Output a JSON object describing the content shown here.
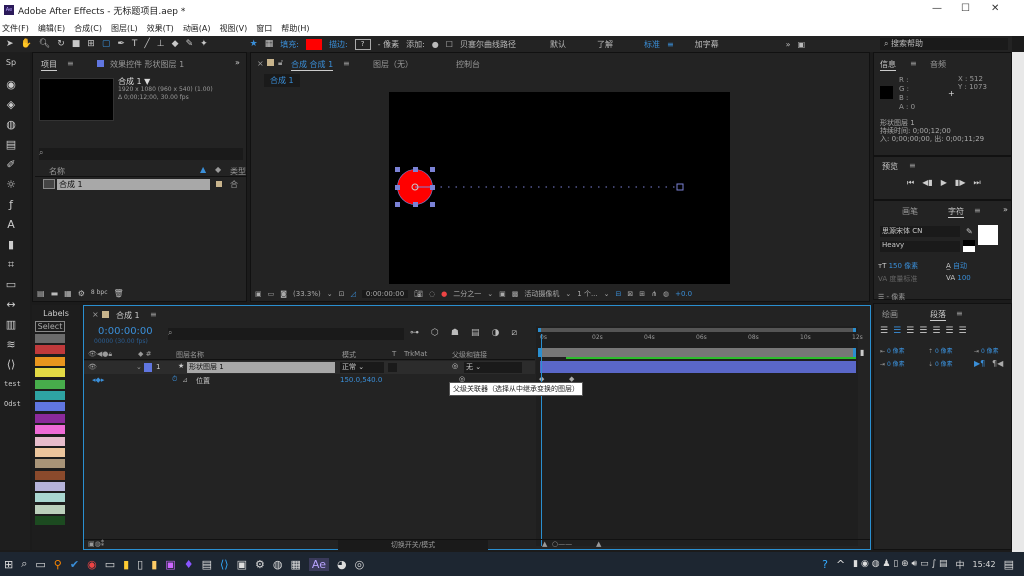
{
  "window": {
    "title": "Adobe After Effects - 无标题项目.aep *",
    "logo": "Ae"
  },
  "menu": [
    "文件(F)",
    "编辑(E)",
    "合成(C)",
    "图层(L)",
    "效果(T)",
    "动画(A)",
    "视图(V)",
    "窗口",
    "帮助(H)"
  ],
  "toolbar": {
    "fill_label": "填充:",
    "stroke_label": "描边:",
    "stroke_value": "?",
    "px_label": "- 像素",
    "add_label": "添加:",
    "bezier_label": "贝塞尔曲线路径",
    "workspaces": [
      "默认",
      "了解",
      "标准",
      "加字幕"
    ],
    "active_workspace": "标准",
    "search_placeholder": "搜索帮助",
    "fill_color": "#ff0000"
  },
  "project": {
    "tab": "项目",
    "effects_tab": "效果控件 形状图层 1",
    "comp_name": "合成 1 ▼",
    "comp_size": "1920 x 1080  (960 x 540) (1.00)",
    "comp_duration": "Δ 0;00;12;00, 30.00 fps",
    "col_name": "名称",
    "col_type": "类型",
    "items": [
      {
        "name": "合成 1",
        "type": "合"
      }
    ],
    "bpc": "8 bpc"
  },
  "comp": {
    "tab": "合成 合成 1",
    "layer_tab": "图层（无）",
    "console_tab": "控制台",
    "breadcrumb": "合成 1",
    "zoom": "(33.3%)",
    "timecode": "0:00:00:00",
    "resolution": "二分之一",
    "camera": "活动摄像机",
    "views": "1 个...",
    "exposure": "+0.0"
  },
  "info": {
    "tab": "信息",
    "audio_tab": "音频",
    "r": "R :",
    "g": "G :",
    "b": "B :",
    "a": "A : 0",
    "x": "X : 512",
    "y": "Y : 1073",
    "layer": "形状图层 1",
    "duration": "持续时间: 0;00;12;00",
    "inout": "入: 0;00;00;00,  出: 0;00;11;29"
  },
  "preview": {
    "tab": "预览"
  },
  "character": {
    "brush_tab": "画笔",
    "tab": "字符",
    "font": "思源宋体 CN",
    "style": "Heavy",
    "size": "150 像素",
    "leading": "自动",
    "kerning": "度量标准",
    "tracking": "100",
    "stroke_px": "- 像素"
  },
  "paragraph": {
    "paint_tab": "绘画",
    "tab": "段落",
    "indent_values": [
      "0 像素",
      "0 像素",
      "0 像素",
      "0 像素",
      "0 像素"
    ]
  },
  "labels": {
    "title": "Labels",
    "select": "Select",
    "colors": [
      "#6b6b6b",
      "#c0393b",
      "#e8951d",
      "#e3d944",
      "#47ad4b",
      "#2ea3a3",
      "#6076e0",
      "#8b2a9a",
      "#ee6ad6",
      "#e6bccb",
      "#ecc59c",
      "#a89478",
      "#8a4a2c",
      "#b5b3d9",
      "#a9d6d0",
      "#bcd0bc",
      "#1c4a20"
    ],
    "extras": [
      "test",
      "Odst"
    ]
  },
  "timeline": {
    "tab": "合成 1",
    "timecode": "0:00:00:00",
    "fps": "00000 (30.00 fps)",
    "columns": {
      "name": "图层名称",
      "mode": "模式",
      "t": "T",
      "trkmat": "TrkMat",
      "parent": "父级和链接"
    },
    "layer": {
      "index": "1",
      "name": "形状图层 1",
      "mode": "正常",
      "parent": "无"
    },
    "property": {
      "name": "位置",
      "value": "150.0,540.0"
    },
    "ruler": [
      "0s",
      "02s",
      "04s",
      "06s",
      "08s",
      "10s",
      "12s"
    ],
    "tooltip": "父级关联器（选择从中继承变换的图层）",
    "toggle_label": "切换开关/模式",
    "layer_color": "#6076e0"
  },
  "taskbar": {
    "time": "15:42",
    "ime": "中"
  }
}
